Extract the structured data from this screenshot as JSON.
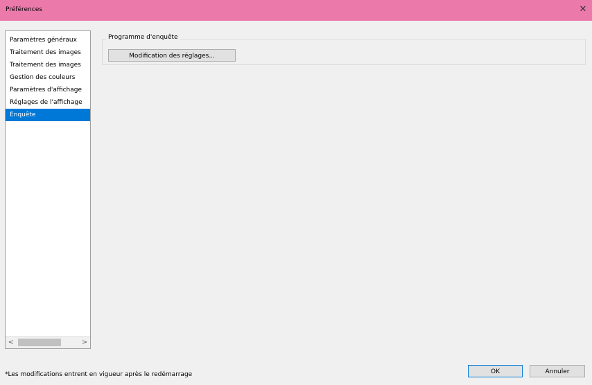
{
  "window": {
    "title": "Préférences",
    "close_symbol": "✕"
  },
  "sidebar": {
    "items": [
      {
        "label": "Paramètres généraux"
      },
      {
        "label": "Traitement des images"
      },
      {
        "label": "Traitement des images"
      },
      {
        "label": "Gestion des couleurs"
      },
      {
        "label": "Paramètres d'affichage"
      },
      {
        "label": "Réglages de l'affichage"
      },
      {
        "label": "Enquête"
      }
    ],
    "selected_index": 6,
    "scroll_left": "<",
    "scroll_right": ">"
  },
  "panel": {
    "group_label": "Programme d'enquête",
    "modify_button": "Modification des réglages..."
  },
  "footer": {
    "note": "*Les modifications entrent en vigueur après le redémarrage",
    "ok_label": "OK",
    "cancel_label": "Annuler"
  },
  "colors": {
    "titlebar": "#eb7aab",
    "selection": "#0078d7",
    "background": "#f0f0f0"
  },
  "icons": {
    "close": "close-icon"
  }
}
